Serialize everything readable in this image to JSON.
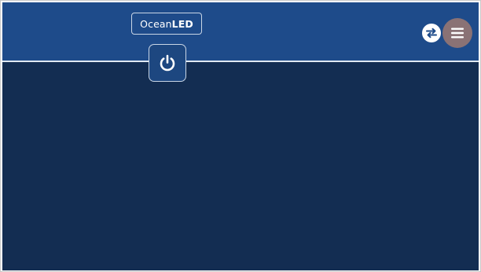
{
  "header": {
    "logo": {
      "part1": "Ocean",
      "part2": "LED"
    },
    "power_icon": "power-icon",
    "swap_icon": "swap-arrows-icon",
    "menu_icon": "hamburger-menu-icon"
  },
  "colors": {
    "header_bg": "#1e4b8a",
    "body_bg": "#132d52",
    "menu_button_bg": "#8a7275",
    "divider": "#dfe8f2"
  }
}
